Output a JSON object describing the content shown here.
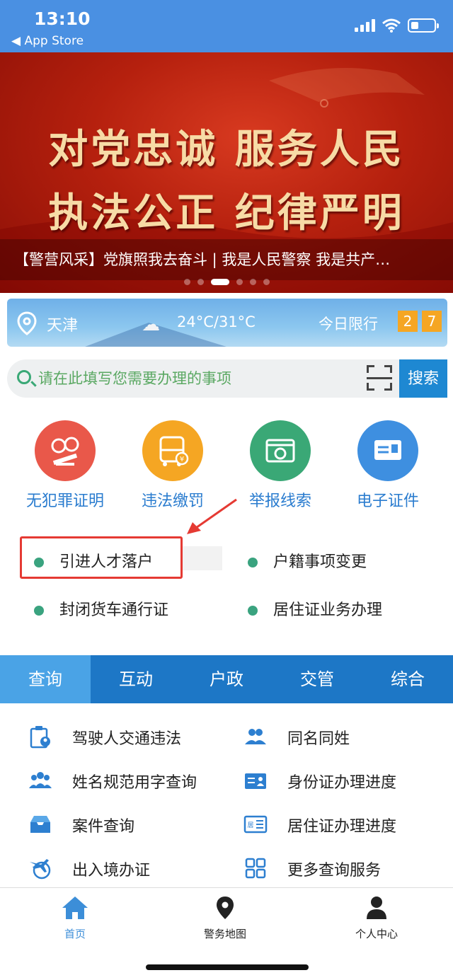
{
  "status_bar": {
    "time": "13:10",
    "back_label": "◀ App Store"
  },
  "banner": {
    "slogan_line1": "对党忠诚  服务人民",
    "slogan_line2": "执法公正  纪律严明",
    "caption": "【警营风采】党旗照我去奋斗 | 我是人民警察 我是共产…",
    "dots": 6,
    "active_dot": 2
  },
  "weather": {
    "city": "天津",
    "temperature": "24°C/31°C",
    "limit_label": "今日限行",
    "limit_numbers": [
      "2",
      "7"
    ]
  },
  "search": {
    "placeholder": "请在此填写您需要办理的事项",
    "button_label": "搜索"
  },
  "services": [
    {
      "label": "无犯罪证明",
      "color": "#e9584a",
      "icon": "handcuffs-icon"
    },
    {
      "label": "违法缴罚",
      "color": "#f5a623",
      "icon": "bus-payment-icon"
    },
    {
      "label": "举报线索",
      "color": "#3aa876",
      "icon": "camera-icon"
    },
    {
      "label": "电子证件",
      "color": "#3e8fe0",
      "icon": "id-card-icon"
    }
  ],
  "quick_links": [
    {
      "label": "引进人才落户"
    },
    {
      "label": "户籍事项变更"
    },
    {
      "label": "封闭货车通行证"
    },
    {
      "label": "居住证业务办理"
    }
  ],
  "tabs": [
    {
      "label": "查询",
      "active": true
    },
    {
      "label": "互动",
      "active": false
    },
    {
      "label": "户政",
      "active": false
    },
    {
      "label": "交管",
      "active": false
    },
    {
      "label": "综合",
      "active": false
    }
  ],
  "query_items": [
    {
      "label": "驾驶人交通违法",
      "icon": "clipboard-person-icon"
    },
    {
      "label": "同名同姓",
      "icon": "people-icon"
    },
    {
      "label": "姓名规范用字查询",
      "icon": "group-icon"
    },
    {
      "label": "身份证办理进度",
      "icon": "id-card-icon"
    },
    {
      "label": "案件查询",
      "icon": "inbox-icon"
    },
    {
      "label": "居住证办理进度",
      "icon": "residence-card-icon"
    },
    {
      "label": "出入境办证",
      "icon": "plane-globe-icon"
    },
    {
      "label": "更多查询服务",
      "icon": "grid-icon"
    }
  ],
  "bottom_nav": [
    {
      "label": "首页",
      "active": true,
      "icon": "home-icon"
    },
    {
      "label": "警务地图",
      "active": false,
      "icon": "map-pin-icon"
    },
    {
      "label": "个人中心",
      "active": false,
      "icon": "person-icon"
    }
  ],
  "colors": {
    "primary": "#1d77c6",
    "active_tab": "#4aa3e6",
    "status_bar": "#4a90e2",
    "highlight_box": "#e53a33",
    "badge": "#f5a623"
  }
}
